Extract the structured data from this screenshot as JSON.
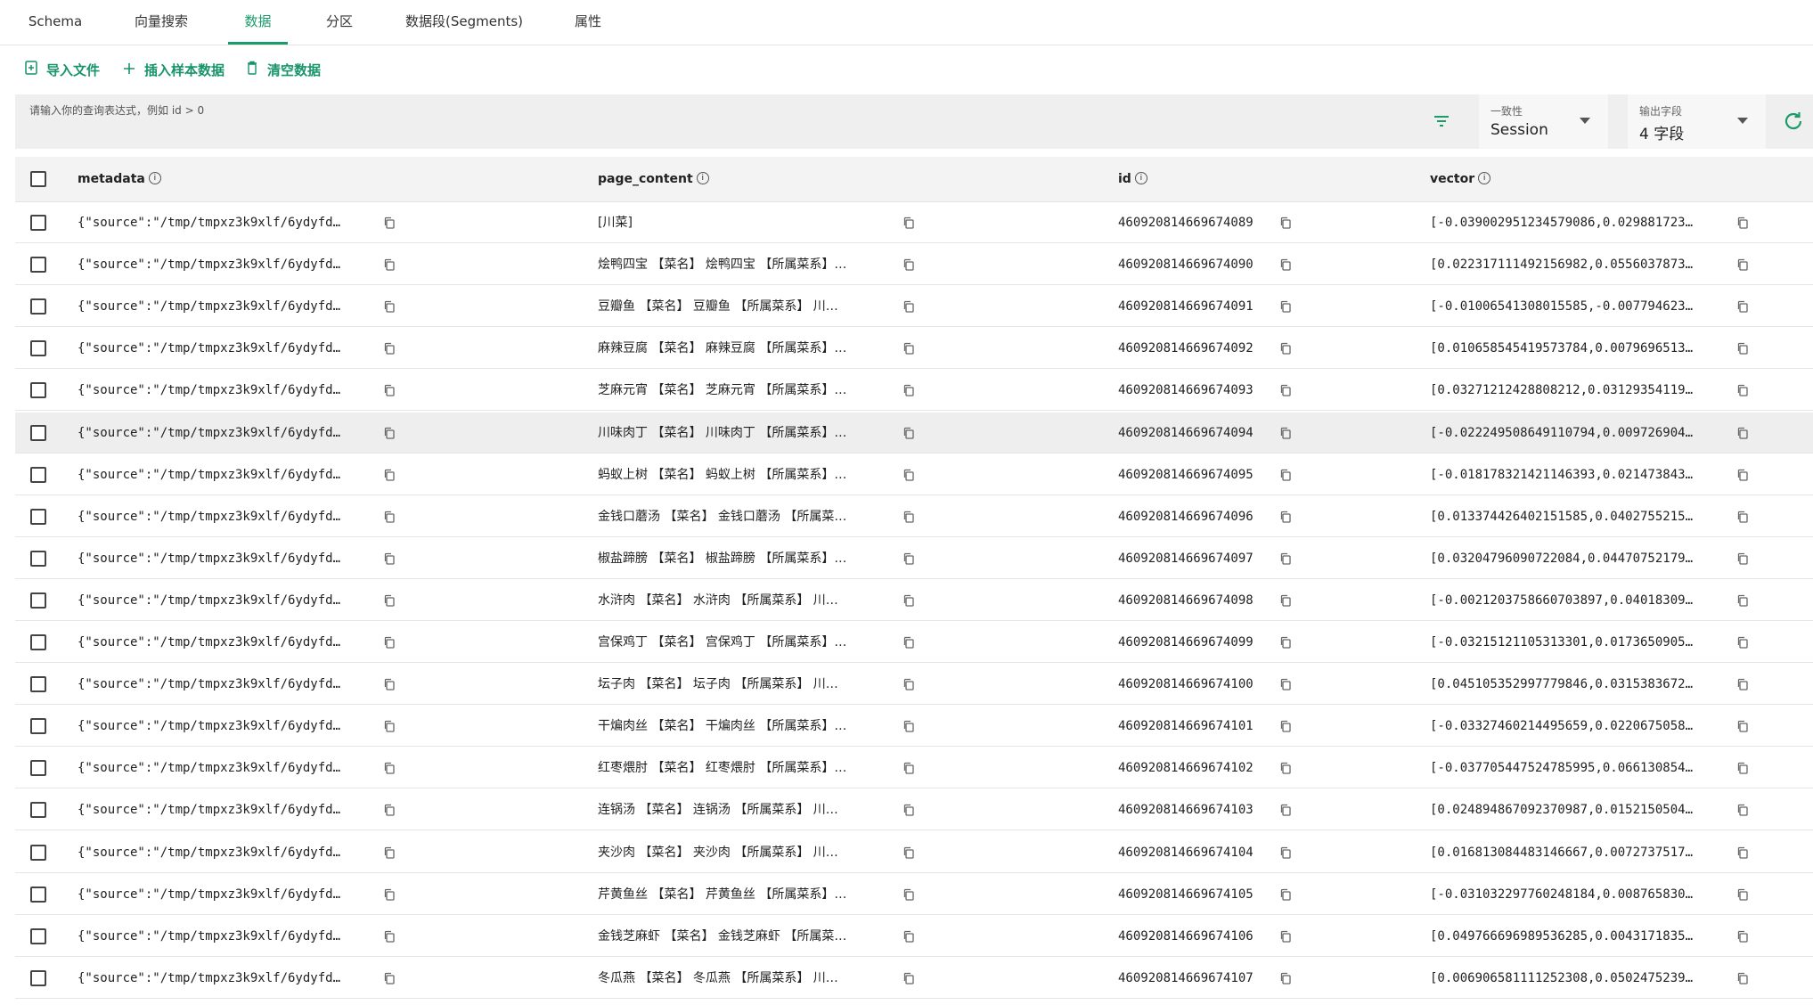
{
  "tabs": [
    {
      "label": "Schema",
      "active": false
    },
    {
      "label": "向量搜索",
      "active": false
    },
    {
      "label": "数据",
      "active": true
    },
    {
      "label": "分区",
      "active": false
    },
    {
      "label": "数据段(Segments)",
      "active": false
    },
    {
      "label": "属性",
      "active": false
    }
  ],
  "toolbar": {
    "import_label": "导入文件",
    "insert_sample_label": "插入样本数据",
    "clear_label": "清空数据"
  },
  "query": {
    "placeholder": "请输入你的查询表达式，例如 id > 0",
    "consistency_label": "一致性",
    "consistency_value": "Session",
    "output_fields_label": "输出字段",
    "output_fields_value": "4 字段"
  },
  "table": {
    "columns": [
      "metadata",
      "page_content",
      "id",
      "vector"
    ],
    "rows": [
      {
        "metadata": "{\"source\":\"/tmp/tmpxz3k9xlf/6ydyfd…",
        "page_content": "[川菜]",
        "id": "460920814669674089",
        "vector": "[-0.039002951234579086,0.029881723…"
      },
      {
        "metadata": "{\"source\":\"/tmp/tmpxz3k9xlf/6ydyfd…",
        "page_content": "烩鸭四宝 【菜名】 烩鸭四宝 【所属菜系】…",
        "id": "460920814669674090",
        "vector": "[0.022317111492156982,0.0556037873…"
      },
      {
        "metadata": "{\"source\":\"/tmp/tmpxz3k9xlf/6ydyfd…",
        "page_content": "豆瓣鱼 【菜名】 豆瓣鱼 【所属菜系】 川…",
        "id": "460920814669674091",
        "vector": "[-0.01006541308015585,-0.007794623…"
      },
      {
        "metadata": "{\"source\":\"/tmp/tmpxz3k9xlf/6ydyfd…",
        "page_content": "麻辣豆腐 【菜名】 麻辣豆腐 【所属菜系】…",
        "id": "460920814669674092",
        "vector": "[0.010658545419573784,0.0079696513…"
      },
      {
        "metadata": "{\"source\":\"/tmp/tmpxz3k9xlf/6ydyfd…",
        "page_content": "芝麻元宵 【菜名】 芝麻元宵 【所属菜系】…",
        "id": "460920814669674093",
        "vector": "[0.03271212428808212,0.03129354119…"
      },
      {
        "metadata": "{\"source\":\"/tmp/tmpxz3k9xlf/6ydyfd…",
        "page_content": "川味肉丁 【菜名】 川味肉丁 【所属菜系】…",
        "id": "460920814669674094",
        "vector": "[-0.022249508649110794,0.009726904…"
      },
      {
        "metadata": "{\"source\":\"/tmp/tmpxz3k9xlf/6ydyfd…",
        "page_content": "蚂蚁上树 【菜名】 蚂蚁上树 【所属菜系】…",
        "id": "460920814669674095",
        "vector": "[-0.018178321421146393,0.021473843…"
      },
      {
        "metadata": "{\"source\":\"/tmp/tmpxz3k9xlf/6ydyfd…",
        "page_content": "金钱口蘑汤 【菜名】 金钱口蘑汤 【所属菜…",
        "id": "460920814669674096",
        "vector": "[0.013374426402151585,0.0402755215…"
      },
      {
        "metadata": "{\"source\":\"/tmp/tmpxz3k9xlf/6ydyfd…",
        "page_content": "椒盐蹄膀 【菜名】 椒盐蹄膀 【所属菜系】…",
        "id": "460920814669674097",
        "vector": "[0.03204796090722084,0.04470752179…"
      },
      {
        "metadata": "{\"source\":\"/tmp/tmpxz3k9xlf/6ydyfd…",
        "page_content": "水浒肉 【菜名】 水浒肉 【所属菜系】 川…",
        "id": "460920814669674098",
        "vector": "[-0.0021203758660703897,0.04018309…"
      },
      {
        "metadata": "{\"source\":\"/tmp/tmpxz3k9xlf/6ydyfd…",
        "page_content": "宫保鸡丁 【菜名】 宫保鸡丁 【所属菜系】…",
        "id": "460920814669674099",
        "vector": "[-0.03215121105313301,0.0173650905…"
      },
      {
        "metadata": "{\"source\":\"/tmp/tmpxz3k9xlf/6ydyfd…",
        "page_content": "坛子肉 【菜名】 坛子肉 【所属菜系】 川…",
        "id": "460920814669674100",
        "vector": "[0.045105352997779846,0.0315383672…"
      },
      {
        "metadata": "{\"source\":\"/tmp/tmpxz3k9xlf/6ydyfd…",
        "page_content": "干煸肉丝 【菜名】 干煸肉丝 【所属菜系】…",
        "id": "460920814669674101",
        "vector": "[-0.03327460214495659,0.0220675058…"
      },
      {
        "metadata": "{\"source\":\"/tmp/tmpxz3k9xlf/6ydyfd…",
        "page_content": "红枣煨肘 【菜名】 红枣煨肘 【所属菜系】…",
        "id": "460920814669674102",
        "vector": "[-0.037705447524785995,0.066130854…"
      },
      {
        "metadata": "{\"source\":\"/tmp/tmpxz3k9xlf/6ydyfd…",
        "page_content": "连锅汤 【菜名】 连锅汤 【所属菜系】 川…",
        "id": "460920814669674103",
        "vector": "[0.024894867092370987,0.0152150504…"
      },
      {
        "metadata": "{\"source\":\"/tmp/tmpxz3k9xlf/6ydyfd…",
        "page_content": "夹沙肉 【菜名】 夹沙肉 【所属菜系】 川…",
        "id": "460920814669674104",
        "vector": "[0.016813084483146667,0.0072737517…"
      },
      {
        "metadata": "{\"source\":\"/tmp/tmpxz3k9xlf/6ydyfd…",
        "page_content": "芹黄鱼丝 【菜名】 芹黄鱼丝 【所属菜系】…",
        "id": "460920814669674105",
        "vector": "[-0.031032297760248184,0.008765830…"
      },
      {
        "metadata": "{\"source\":\"/tmp/tmpxz3k9xlf/6ydyfd…",
        "page_content": "金钱芝麻虾 【菜名】 金钱芝麻虾 【所属菜…",
        "id": "460920814669674106",
        "vector": "[0.049766696989536285,0.0043171835…"
      },
      {
        "metadata": "{\"source\":\"/tmp/tmpxz3k9xlf/6ydyfd…",
        "page_content": "冬瓜燕 【菜名】 冬瓜燕 【所属菜系】 川…",
        "id": "460920814669674107",
        "vector": "[0.006906581111252308,0.0502475239…"
      }
    ]
  },
  "colors": {
    "accent": "#1b9b6a",
    "row_highlight": "#eeeeee",
    "query_bar": "#efefef"
  }
}
